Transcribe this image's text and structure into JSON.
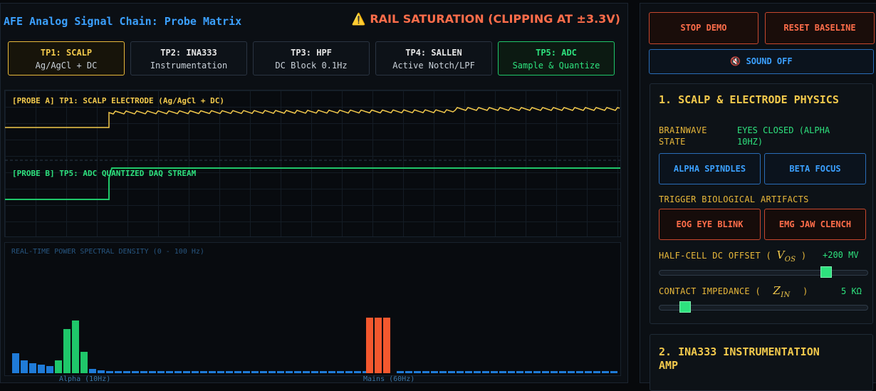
{
  "header": {
    "title": "AFE Analog Signal Chain: Probe Matrix",
    "warning_icon": "warning-triangle-icon",
    "warning": "⚠️ RAIL SATURATION (CLIPPING AT ±3.3V)"
  },
  "tabs": [
    {
      "label": "TP1: SCALP",
      "sub": "Ag/AgCl + DC"
    },
    {
      "label": "TP2: INA333",
      "sub": "Instrumentation"
    },
    {
      "label": "TP3: HPF",
      "sub": "DC Block 0.1Hz"
    },
    {
      "label": "TP4: SALLEN",
      "sub": "Active Notch/LPF"
    },
    {
      "label": "TP5: ADC",
      "sub": "Sample & Quantize"
    }
  ],
  "scope": {
    "probe_a": "[PROBE A] TP1: SCALP ELECTRODE (Ag/AgCl + DC)",
    "probe_b": "[PROBE B] TP5: ADC QUANTIZED DAQ STREAM"
  },
  "psd": {
    "title": "REAL-TIME POWER SPECTRAL DENSITY (0 - 100 Hz)",
    "label_alpha": "Alpha (10Hz)",
    "label_mains": "Mains (60Hz)"
  },
  "controls": {
    "stop_demo": "STOP DEMO",
    "reset_baseline": "RESET BASELINE",
    "sound_icon": "speaker-muted-icon",
    "sound": "🔇 SOUND OFF"
  },
  "panel1": {
    "title": "1. SCALP & ELECTRODE PHYSICS",
    "brainwave_label_1": "BRAINWAVE",
    "brainwave_label_2": "STATE",
    "brainwave_value_1": "EYES CLOSED (ALPHA",
    "brainwave_value_2": "10HZ)",
    "alpha_button": "ALPHA SPINDLES",
    "beta_button": "BETA FOCUS",
    "artifacts_label": "TRIGGER BIOLOGICAL ARTIFACTS",
    "eog_button": "EOG EYE BLINK",
    "emg_button": "EMG JAW CLENCH",
    "offset_label": "HALF-CELL DC OFFSET (",
    "offset_symbol": "V",
    "offset_sub": "OS",
    "offset_close": ")",
    "offset_value": "+200 MV",
    "offset_level": 0.82,
    "impedance_label": "CONTACT IMPEDANCE (",
    "impedance_symbol": "Z",
    "impedance_sub": "IN",
    "impedance_close": ")",
    "impedance_value": "5 KΩ",
    "impedance_level": 0.1
  },
  "panel2": {
    "title_1": "2. INA333 INSTRUMENTATION",
    "title_2": "AMP"
  },
  "colors": {
    "accent_blue": "#3ba0ff",
    "probe_a_yellow": "#f2c94c",
    "probe_b_green": "#2ee27e",
    "alert_red": "#ff6d4a",
    "psd_blue": "#1f7bd8",
    "psd_green": "#1fc76a",
    "psd_red": "#f4582e"
  }
}
